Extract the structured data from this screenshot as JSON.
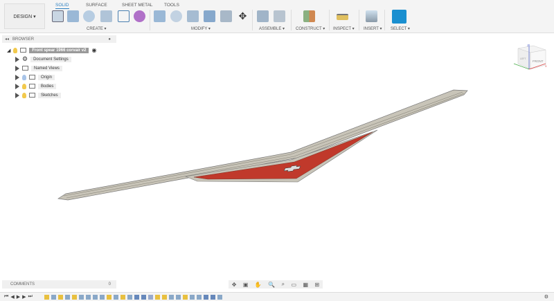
{
  "toolbar": {
    "design_label": "DESIGN ▾",
    "tabs": [
      "SOLID",
      "SURFACE",
      "SHEET METAL",
      "TOOLS"
    ],
    "groups": [
      "CREATE ▾",
      "MODIFY ▾",
      "ASSEMBLE ▾",
      "CONSTRUCT ▾",
      "INSPECT ▾",
      "INSERT ▾",
      "SELECT ▾"
    ]
  },
  "browser": {
    "title": "BROWSER",
    "root": "Front spear 1966 corvair v2",
    "items": [
      "Document Settings",
      "Named Views",
      "Origin",
      "Bodies",
      "Sketches"
    ]
  },
  "comments": {
    "label": "COMMENTS",
    "count": "0"
  },
  "viewcube": {
    "face_front": "FRONT",
    "face_left": "LEFT",
    "axis_z": "Z",
    "axis_x": "X"
  },
  "timeline": {
    "controls": [
      "⏮",
      "◀",
      "▶",
      "▶",
      "⏭"
    ],
    "features": [
      "sketch",
      "extrude",
      "sketch",
      "extrude",
      "sketch",
      "extrude",
      "extrude",
      "extrude",
      "extrude",
      "sketch",
      "extrude",
      "sketch",
      "extrude",
      "combine",
      "combine",
      "fillet",
      "sketch",
      "sketch",
      "extrude",
      "extrude",
      "sketch",
      "extrude",
      "extrude",
      "combine",
      "combine",
      "extrude"
    ]
  },
  "colors": {
    "accent": "#2a7fc0",
    "select": "#1a8fd0",
    "body": "#c8c4b8",
    "red": "#c0392b"
  }
}
